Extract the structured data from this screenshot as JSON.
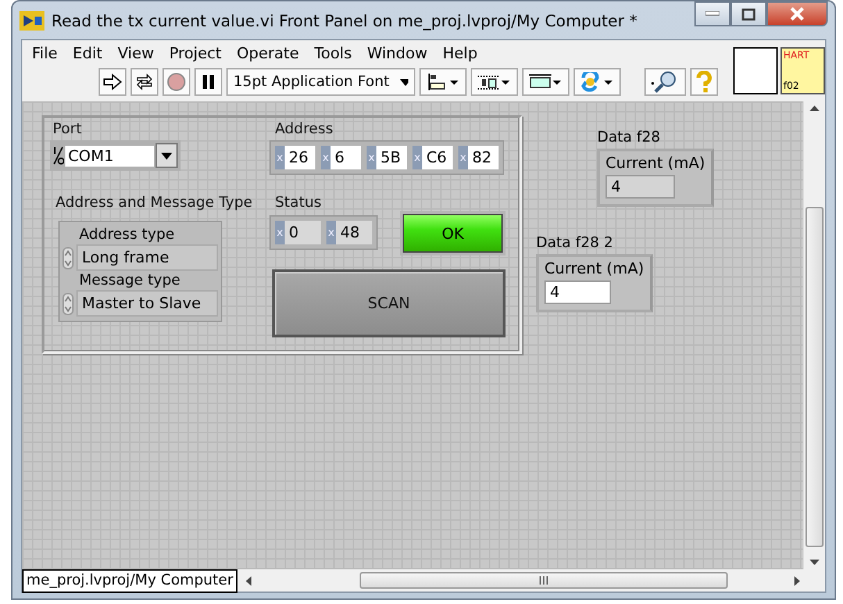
{
  "window": {
    "title": "Read the tx current value.vi Front Panel on me_proj.lvproj/My Computer *"
  },
  "menu": [
    "File",
    "Edit",
    "View",
    "Project",
    "Operate",
    "Tools",
    "Window",
    "Help"
  ],
  "toolbar": {
    "font": "15pt Application Font",
    "abort_disabled": true
  },
  "icon_pane": {
    "top": "HART",
    "bottom": "f02"
  },
  "panel": {
    "port": {
      "label": "Port",
      "value": "COM1"
    },
    "address": {
      "label": "Address",
      "fields": [
        {
          "radix": "x",
          "value": "26"
        },
        {
          "radix": "x",
          "value": "6"
        },
        {
          "radix": "x",
          "value": "5B"
        },
        {
          "radix": "x",
          "value": "C6"
        },
        {
          "radix": "x",
          "value": "82"
        }
      ]
    },
    "address_message_type": {
      "label": "Address and Message Type",
      "rings": [
        {
          "label": "Address type",
          "value": "Long frame"
        },
        {
          "label": "Message type",
          "value": "Master to Slave"
        }
      ]
    },
    "status": {
      "label": "Status",
      "fields": [
        {
          "radix": "x",
          "value": "0"
        },
        {
          "radix": "x",
          "value": "48"
        }
      ]
    },
    "ok_led": {
      "label": "OK",
      "on": true
    },
    "scan_button": {
      "label": "SCAN"
    },
    "indicators": [
      {
        "label": "Data f28",
        "field": "Current (mA)",
        "value": "4",
        "kind": "indicator"
      },
      {
        "label": "Data f28 2",
        "field": "Current (mA)",
        "value": "4",
        "kind": "control"
      }
    ]
  },
  "status_bar": {
    "context": "me_proj.lvproj/My Computer"
  }
}
